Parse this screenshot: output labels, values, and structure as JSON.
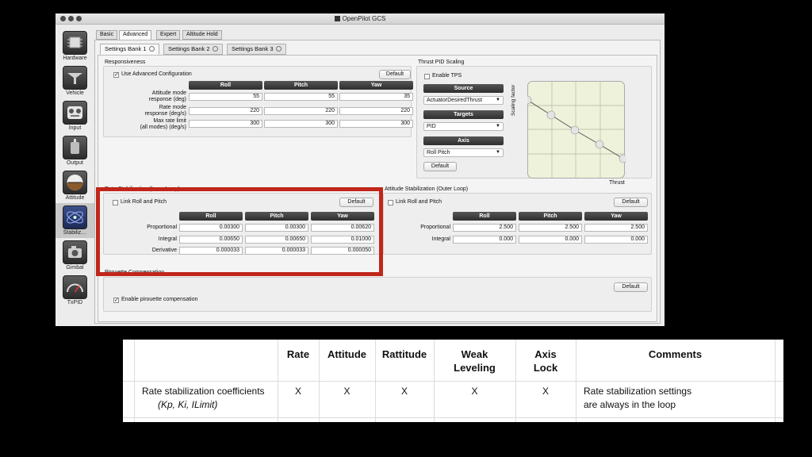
{
  "window": {
    "title": "OpenPilot GCS"
  },
  "sidebar": {
    "items": [
      {
        "label": "Hardware",
        "icon": "hardware-icon"
      },
      {
        "label": "Vehicle",
        "icon": "vehicle-icon"
      },
      {
        "label": "Input",
        "icon": "input-icon"
      },
      {
        "label": "Output",
        "icon": "output-icon"
      },
      {
        "label": "Attitude",
        "icon": "attitude-icon"
      },
      {
        "label": "Stabiliz…",
        "icon": "stabilization-icon",
        "selected": true
      },
      {
        "label": "Gimbal",
        "icon": "gimbal-icon"
      },
      {
        "label": "TxPID",
        "icon": "txpid-icon"
      }
    ]
  },
  "tabs": [
    "Basic",
    "Advanced",
    "Expert",
    "Altitude Hold"
  ],
  "active_tab": "Advanced",
  "bank_tabs": [
    "Settings Bank 1",
    "Settings Bank 2",
    "Settings Bank 3"
  ],
  "responsiveness": {
    "title": "Responsiveness",
    "checkbox_label": "Use Advanced Configuration",
    "checked": true,
    "default_label": "Default",
    "columns": [
      "Roll",
      "Pitch",
      "Yaw"
    ],
    "rows": [
      {
        "label": "Attitude mode\nresponse (deg)",
        "values": [
          "55",
          "55",
          "35"
        ]
      },
      {
        "label": "Rate mode\nresponse (deg/s)",
        "values": [
          "220",
          "220",
          "220"
        ]
      },
      {
        "label": "Max rate limit\n(all modes) (deg/s)",
        "values": [
          "300",
          "300",
          "300"
        ]
      }
    ]
  },
  "thrust": {
    "title": "Thrust PID Scaling",
    "enable_label": "Enable TPS",
    "enabled": false,
    "source_header": "Source",
    "source_value": "ActuatorDesiredThrust",
    "targets_header": "Targets",
    "targets_value": "PID",
    "axis_header": "Axis",
    "axis_value": "Roll Pitch",
    "default_label": "Default",
    "y_label": "Scaling factor",
    "x_label": "Thrust"
  },
  "rate_stab": {
    "title": "Rate Stabilization (Inner Loop)",
    "link_label": "Link Roll and Pitch",
    "linked": false,
    "default_label": "Default",
    "columns": [
      "Roll",
      "Pitch",
      "Yaw"
    ],
    "rows": [
      {
        "label": "Proportional",
        "values": [
          "0.00300",
          "0.00300",
          "0.00620"
        ]
      },
      {
        "label": "Integral",
        "values": [
          "0.00650",
          "0.00650",
          "0.01000"
        ]
      },
      {
        "label": "Derivative",
        "values": [
          "0.000033",
          "0.000033",
          "0.000050"
        ]
      }
    ]
  },
  "att_stab": {
    "title": "Attitude Stabilization (Outer Loop)",
    "link_label": "Link Roll and Pitch",
    "linked": false,
    "default_label": "Default",
    "columns": [
      "Roll",
      "Pitch",
      "Yaw"
    ],
    "rows": [
      {
        "label": "Proportional",
        "values": [
          "2.500",
          "2.500",
          "2.500"
        ]
      },
      {
        "label": "Integral",
        "values": [
          "0.000",
          "0.000",
          "0.000"
        ]
      }
    ]
  },
  "pirouette": {
    "title": "Pirouette Compensation",
    "checkbox_label": "Enable pirouette compensation",
    "checked": true,
    "default_label": "Default"
  },
  "table": {
    "headers": [
      "",
      "Rate",
      "Attitude",
      "Rattitude",
      "Weak\nLeveling",
      "Axis\nLock",
      "Comments"
    ],
    "row": {
      "name": "Rate stabilization coefficients",
      "sub": "(Kp, Ki, ILimit)",
      "marks": [
        "X",
        "X",
        "X",
        "X",
        "X"
      ],
      "comment": "Rate stabilization settings\nare always in the loop"
    }
  },
  "colors": {
    "highlight": "#c0261a",
    "header_dark": "#3a3a3a"
  }
}
